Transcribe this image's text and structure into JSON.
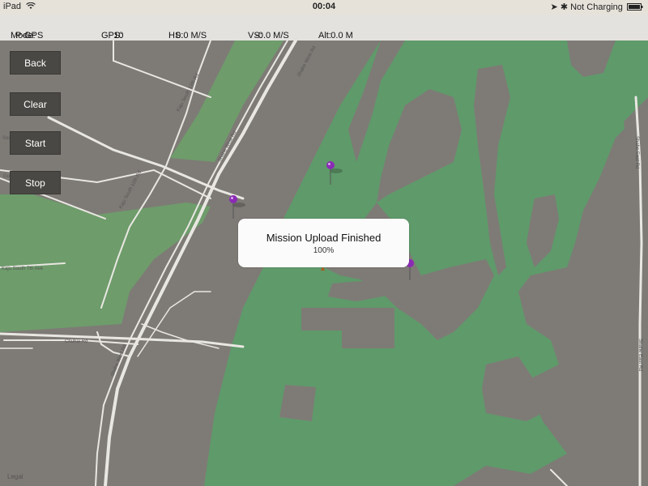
{
  "status_bar": {
    "device": "iPad",
    "time": "00:04",
    "charging": "Not Charging"
  },
  "telemetry": {
    "mode_label": "Mode:",
    "mode_value": "P-GPS",
    "gps_label": "GPS:",
    "gps_value": "10",
    "hs_label": "HS:",
    "hs_value": "0.0 M/S",
    "vs_label": "VS:",
    "vs_value": "-0.0 M/S",
    "alt_label": "Alt:",
    "alt_value": "0.0 M"
  },
  "controls": {
    "back": "Back",
    "clear": "Clear",
    "start": "Start",
    "stop": "Stop"
  },
  "toast": {
    "title": "Mission Upload Finished",
    "progress": "100%"
  },
  "map": {
    "legal": "Legal",
    "road_labels": {
      "kaju_12th": "Kaju South 12th Rd",
      "shahe_west_1": "Shahe West Rd",
      "shahe_west_2": "Shahe West Rd",
      "south_4th": "South 4th Ave",
      "guan_south": "Guanjia South",
      "kaju_12th_b": "Kaju South 12th Rd",
      "south_7th": "Kaju South 7th Ave",
      "shahe_east_1": "Shahe East Rd",
      "shahe_east_2": "Shahe East Rd",
      "shahe_west_3": "Shahe West Rd",
      "chuhai": "Chuhai Rd"
    },
    "colors": {
      "park": "#5f9a6a",
      "land": "#7e7b76",
      "road": "#e9e7e2",
      "waypoint": "#8a2bb5"
    }
  }
}
